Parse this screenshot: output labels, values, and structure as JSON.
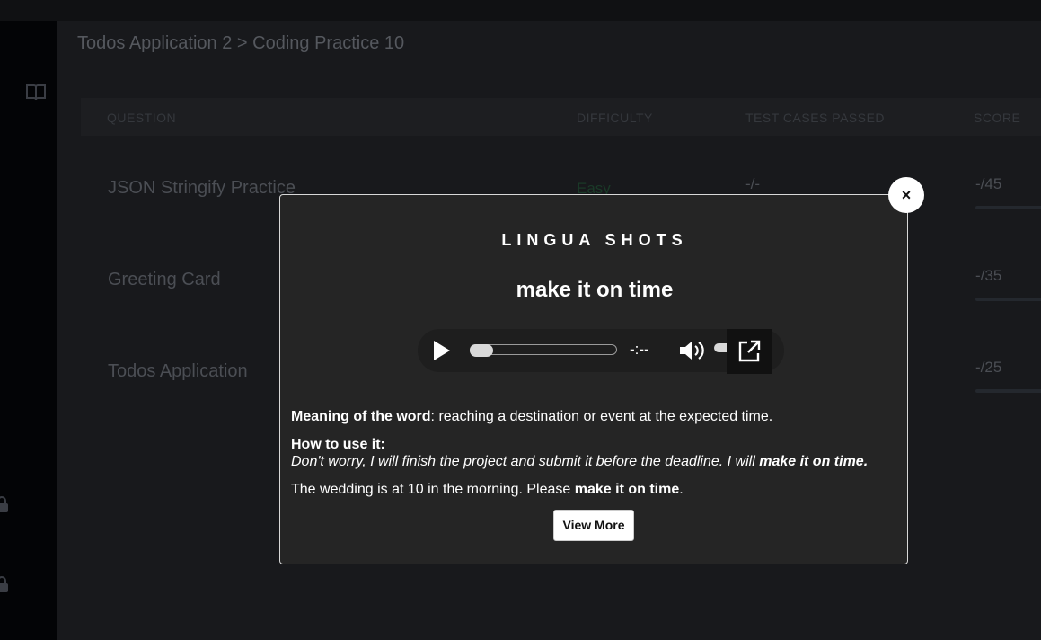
{
  "breadcrumb": "Todos Application 2 > Coding Practice 10",
  "table": {
    "headers": {
      "question": "QUESTION",
      "difficulty": "DIFFICULTY",
      "test_cases": "TEST CASES PASSED",
      "score": "SCORE"
    },
    "rows": [
      {
        "question": "JSON Stringify Practice",
        "difficulty": "Easy",
        "test_cases": "-/-",
        "score": "-/45"
      },
      {
        "question": "Greeting Card",
        "difficulty": "",
        "test_cases": "",
        "score": "-/35"
      },
      {
        "question": "Todos Application",
        "difficulty": "",
        "test_cases": "",
        "score": "-/25"
      }
    ]
  },
  "modal": {
    "close_label": "×",
    "brand": "LINGUA SHOTS",
    "phrase": "make it on time",
    "player": {
      "time": "-:--",
      "progress": 0.0
    },
    "meaning_label": "Meaning of the word",
    "meaning_text": ": reaching a destination or event at the expected time.",
    "howto_label": "How to use it:",
    "example1_text": "Don't worry, I will finish the project and submit it before the deadline. I will ",
    "example1_bold": "make it on time.",
    "example2_text": "The wedding is at 10 in the morning. Please ",
    "example2_bold": "make it on time",
    "example2_end": ".",
    "view_more_label": "View More"
  }
}
